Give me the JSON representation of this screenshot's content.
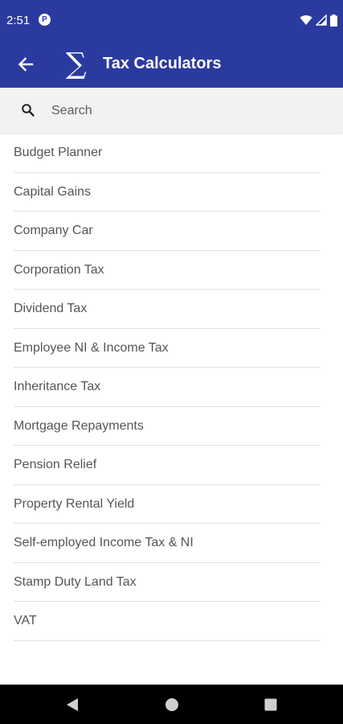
{
  "status_bar": {
    "time": "2:51",
    "app_icon_letter": "P"
  },
  "app_bar": {
    "title": "Tax Calculators",
    "accent_color": "#2b3a9e"
  },
  "search": {
    "placeholder": "Search"
  },
  "calculators": [
    "Budget Planner",
    "Capital Gains",
    "Company Car",
    "Corporation Tax",
    "Dividend Tax",
    "Employee NI & Income Tax",
    "Inheritance Tax",
    "Mortgage Repayments",
    "Pension Relief",
    "Property Rental Yield",
    "Self-employed Income Tax & NI",
    "Stamp Duty Land Tax",
    "VAT"
  ],
  "icons": {
    "back": "arrow-left-icon",
    "app": "sigma-icon",
    "search": "search-icon",
    "nav": [
      "back-triangle-icon",
      "home-circle-icon",
      "recents-square-icon"
    ],
    "status": [
      "wifi-icon",
      "signal-icon",
      "battery-icon"
    ]
  }
}
